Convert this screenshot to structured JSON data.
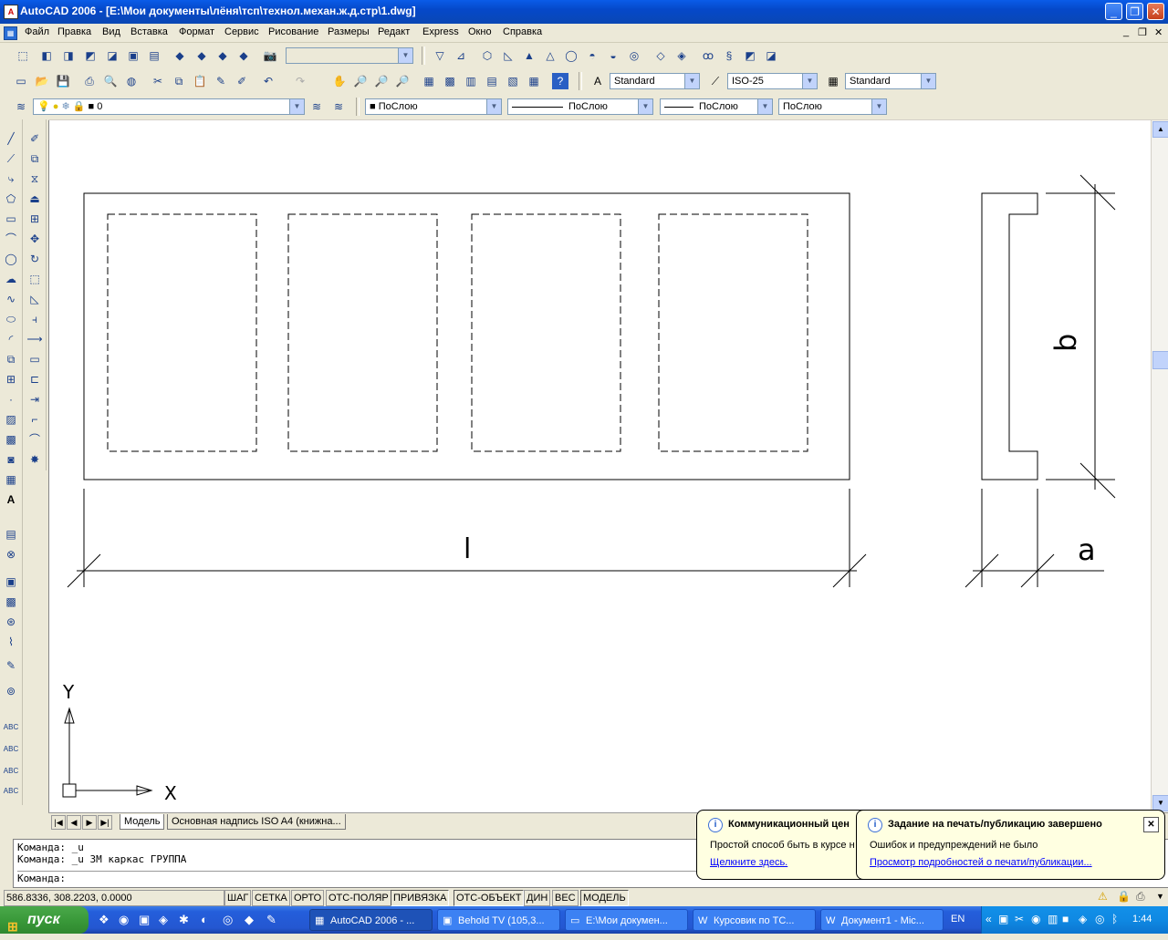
{
  "title": "AutoCAD 2006 - [E:\\Мои документы\\лёня\\тсп\\технол.механ.ж.д.стр\\1.dwg]",
  "menu": [
    "Файл",
    "Правка",
    "Вид",
    "Вставка",
    "Формат",
    "Сервис",
    "Рисование",
    "Размеры",
    "Редакт",
    "Express",
    "Окно",
    "Справка"
  ],
  "toolbar": {
    "text_style": "Standard",
    "dim_style": "ISO-25",
    "table_style": "Standard",
    "layer": "0",
    "color": "ПоСлою",
    "linetype": "ПоСлою",
    "lineweight": "ПоСлою",
    "plotstyle": "ПоСлою"
  },
  "drawing": {
    "dim_l": "l",
    "dim_a": "a",
    "dim_b": "b",
    "axis_y": "Y",
    "axis_x": "X"
  },
  "tabs": {
    "model": "Модель",
    "layout": "Основная надпись ISO A4 (книжна..."
  },
  "command": {
    "line1": "Команда: _u",
    "line2": "Команда: _u 3М каркас ГРУППА",
    "prompt": "Команда:"
  },
  "status": {
    "coords": "586.8336, 308.2203, 0.0000",
    "buttons": [
      "ШАГ",
      "СЕТКА",
      "ОРТО",
      "ОТС-ПОЛЯР",
      "ПРИВЯЗКА",
      "ОТС-ОБЪЕКТ",
      "ДИН",
      "ВЕС",
      "МОДЕЛЬ"
    ]
  },
  "balloon1": {
    "title": "Коммуникационный цен",
    "body": "Простой способ быть в курсе н",
    "link": "Щелкните здесь."
  },
  "balloon2": {
    "title": "Задание на печать/публикацию завершено",
    "body": "Ошибок и предупреждений не было",
    "link": "Просмотр подробностей о печати/публикации..."
  },
  "taskbar": {
    "start": "пуск",
    "tasks": [
      "AutoCAD 2006 - ...",
      "Behold TV (105,3...",
      "E:\\Мои докумен...",
      "Курсовик по ТС...",
      "Документ1 - Mic..."
    ],
    "lang": "EN",
    "clock": "1:44"
  },
  "colors": {
    "accent": "#0a5ce8",
    "start": "#3a9a3a",
    "balloon": "#ffffe1"
  }
}
